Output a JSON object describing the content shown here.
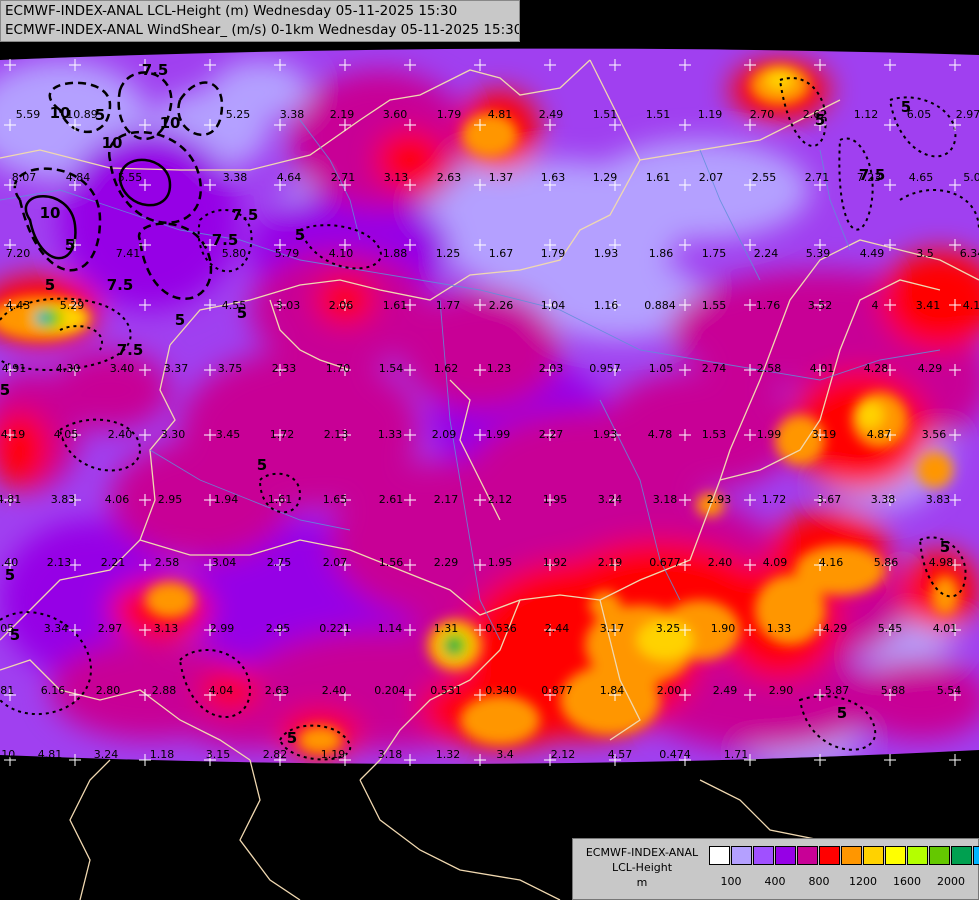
{
  "header": {
    "line1": "ECMWF-INDEX-ANAL LCL-Height (m) Wednesday 05-11-2025 15:30",
    "line2": "ECMWF-INDEX-ANAL WindShear_ (m/s) 0-1km Wednesday 05-11-2025 15:30"
  },
  "legend": {
    "line1": "ECMWF-INDEX-ANAL",
    "line2": "LCL-Height",
    "line3": "m",
    "colors": [
      "#ffffff",
      "#b4a0ff",
      "#a050ff",
      "#9600e6",
      "#c80096",
      "#ff0000",
      "#ff9600",
      "#ffd200",
      "#ffff00",
      "#b4ff00",
      "#64c800",
      "#00a050",
      "#00b4ff"
    ],
    "ticks": [
      "100",
      "400",
      "800",
      "1200",
      "1600",
      "2000"
    ]
  },
  "shear_values": [
    {
      "t": "5.59"
    },
    {
      "t": "10.89"
    },
    {
      "t": "5.25"
    },
    {
      "t": "3.38"
    },
    {
      "t": "2.19"
    },
    {
      "t": "3.60"
    },
    {
      "t": "1.79"
    },
    {
      "t": "4.81"
    },
    {
      "t": "2.49"
    },
    {
      "t": "1.51"
    },
    {
      "t": "1.51"
    },
    {
      "t": "1.19"
    },
    {
      "t": "2.70"
    },
    {
      "t": "2.62"
    },
    {
      "t": "1.12"
    },
    {
      "t": "6.05"
    },
    {
      "t": "2.97"
    },
    {
      "t": "8.07"
    },
    {
      "t": "4.84"
    },
    {
      "t": "5.55"
    },
    {
      "t": "3.38"
    },
    {
      "t": "4.64"
    },
    {
      "t": "2.71"
    },
    {
      "t": "3.13"
    },
    {
      "t": "2.63"
    },
    {
      "t": "1.37"
    },
    {
      "t": "1.63"
    },
    {
      "t": "1.29"
    },
    {
      "t": "1.61"
    },
    {
      "t": "2.07"
    },
    {
      "t": "2.55"
    },
    {
      "t": "2.71"
    },
    {
      "t": "7.23"
    },
    {
      "t": "4.65"
    },
    {
      "t": "5.0"
    },
    {
      "t": "7.20"
    },
    {
      "t": "7.41"
    },
    {
      "t": "5.80"
    },
    {
      "t": "5.79"
    },
    {
      "t": "4.10"
    },
    {
      "t": "1.88"
    },
    {
      "t": "1.25"
    },
    {
      "t": "1.67"
    },
    {
      "t": "1.79"
    },
    {
      "t": "1.93"
    },
    {
      "t": "1.86"
    },
    {
      "t": "1.75"
    },
    {
      "t": "2.24"
    },
    {
      "t": "5.39"
    },
    {
      "t": "4.49"
    },
    {
      "t": "3.5"
    },
    {
      "t": "6.34"
    },
    {
      "t": "4.43"
    },
    {
      "t": "5.29"
    },
    {
      "t": "4.55"
    },
    {
      "t": "3.03"
    },
    {
      "t": "2.06"
    },
    {
      "t": "1.61"
    },
    {
      "t": "1.77"
    },
    {
      "t": "2.26"
    },
    {
      "t": "1.04"
    },
    {
      "t": "1.16"
    },
    {
      "t": "0.884"
    },
    {
      "t": "1.55"
    },
    {
      "t": "1.76"
    },
    {
      "t": "3.52"
    },
    {
      "t": "4"
    },
    {
      "t": "3.41"
    },
    {
      "t": "4.19"
    },
    {
      "t": "4.91"
    },
    {
      "t": "4.30"
    },
    {
      "t": "3.40"
    },
    {
      "t": "3.37"
    },
    {
      "t": "3.75"
    },
    {
      "t": "2.33"
    },
    {
      "t": "1.70"
    },
    {
      "t": "1.54"
    },
    {
      "t": "1.62"
    },
    {
      "t": "1.23"
    },
    {
      "t": "2.03"
    },
    {
      "t": "0.957"
    },
    {
      "t": "1.05"
    },
    {
      "t": "2.74"
    },
    {
      "t": "2.58"
    },
    {
      "t": "4.01"
    },
    {
      "t": "4.28"
    },
    {
      "t": "4.29"
    },
    {
      "t": "4.19"
    },
    {
      "t": "4.05"
    },
    {
      "t": "2.40"
    },
    {
      "t": "3.30"
    },
    {
      "t": "3.45"
    },
    {
      "t": "1.72"
    },
    {
      "t": "2.13"
    },
    {
      "t": "1.33"
    },
    {
      "t": "2.09"
    },
    {
      "t": "1.99"
    },
    {
      "t": "2.27"
    },
    {
      "t": "1.93"
    },
    {
      "t": "4.78"
    },
    {
      "t": "1.53"
    },
    {
      "t": "1.99"
    },
    {
      "t": "3.19"
    },
    {
      "t": "4.87"
    },
    {
      "t": "3.56"
    },
    {
      "t": "4.81"
    },
    {
      "t": "3.83"
    },
    {
      "t": "4.06"
    },
    {
      "t": "2.95"
    },
    {
      "t": "1.94"
    },
    {
      "t": "1.61"
    },
    {
      "t": "1.65"
    },
    {
      "t": "2.61"
    },
    {
      "t": "2.17"
    },
    {
      "t": "2.12"
    },
    {
      "t": "1.95"
    },
    {
      "t": "3.24"
    },
    {
      "t": "3.18"
    },
    {
      "t": "2.93"
    },
    {
      "t": "1.72"
    },
    {
      "t": "3.67"
    },
    {
      "t": "3.38"
    },
    {
      "t": "3.83"
    },
    {
      "t": "3.40"
    },
    {
      "t": "2.13"
    },
    {
      "t": "2.21"
    },
    {
      "t": "2.58"
    },
    {
      "t": "3.04"
    },
    {
      "t": "2.75"
    },
    {
      "t": "2.07"
    },
    {
      "t": "1.56"
    },
    {
      "t": "2.29"
    },
    {
      "t": "1.95"
    },
    {
      "t": "1.92"
    },
    {
      "t": "2.19"
    },
    {
      "t": "0.677"
    },
    {
      "t": "2.40"
    },
    {
      "t": "4.09"
    },
    {
      "t": "4.16"
    },
    {
      "t": "5.86"
    },
    {
      "t": "4.98"
    },
    {
      "t": "3.05"
    },
    {
      "t": "3.34"
    },
    {
      "t": "2.97"
    },
    {
      "t": "3.13"
    },
    {
      "t": "2.99"
    },
    {
      "t": "2.95"
    },
    {
      "t": "0.221"
    },
    {
      "t": "1.14"
    },
    {
      "t": "1.31"
    },
    {
      "t": "0.536"
    },
    {
      "t": "2.44"
    },
    {
      "t": "3.17"
    },
    {
      "t": "3.25"
    },
    {
      "t": "1.90"
    },
    {
      "t": "1.33"
    },
    {
      "t": "4.29"
    },
    {
      "t": "5.45"
    },
    {
      "t": "4.01"
    },
    {
      "t": "5.81"
    },
    {
      "t": "6.16"
    },
    {
      "t": "2.80"
    },
    {
      "t": "2.88"
    },
    {
      "t": "4.04"
    },
    {
      "t": "2.63"
    },
    {
      "t": "2.40"
    },
    {
      "t": "0.204"
    },
    {
      "t": "0.531"
    },
    {
      "t": "0.340"
    },
    {
      "t": "0.877"
    },
    {
      "t": "1.84"
    },
    {
      "t": "2.00"
    },
    {
      "t": "2.49"
    },
    {
      "t": "2.90"
    },
    {
      "t": "5.87"
    },
    {
      "t": "5.88"
    },
    {
      "t": "5.54"
    },
    {
      "t": "1.10"
    },
    {
      "t": "4.81"
    },
    {
      "t": "3.24"
    },
    {
      "t": "1.18"
    },
    {
      "t": "3.15"
    },
    {
      "t": "2.82"
    },
    {
      "t": "1.19"
    },
    {
      "t": "3.18"
    },
    {
      "t": "1.32"
    },
    {
      "t": "3.4"
    },
    {
      "t": "2.12"
    },
    {
      "t": "4.57"
    },
    {
      "t": "0.474"
    },
    {
      "t": "1.71"
    }
  ],
  "contour_labels": [
    {
      "t": "10"
    },
    {
      "t": "10"
    },
    {
      "t": "7.5"
    },
    {
      "t": "10"
    },
    {
      "t": "5"
    },
    {
      "t": "7.5"
    },
    {
      "t": "10"
    },
    {
      "t": "7.5"
    },
    {
      "t": "5"
    },
    {
      "t": "5"
    },
    {
      "t": "7.5"
    },
    {
      "t": "5"
    },
    {
      "t": "5"
    },
    {
      "t": "5"
    },
    {
      "t": "7.5"
    },
    {
      "t": "5"
    },
    {
      "t": "5"
    },
    {
      "t": "5"
    },
    {
      "t": "5"
    },
    {
      "t": "5"
    },
    {
      "t": "5"
    },
    {
      "t": "5"
    },
    {
      "t": "5"
    },
    {
      "t": "7.5"
    },
    {
      "t": "5"
    }
  ]
}
